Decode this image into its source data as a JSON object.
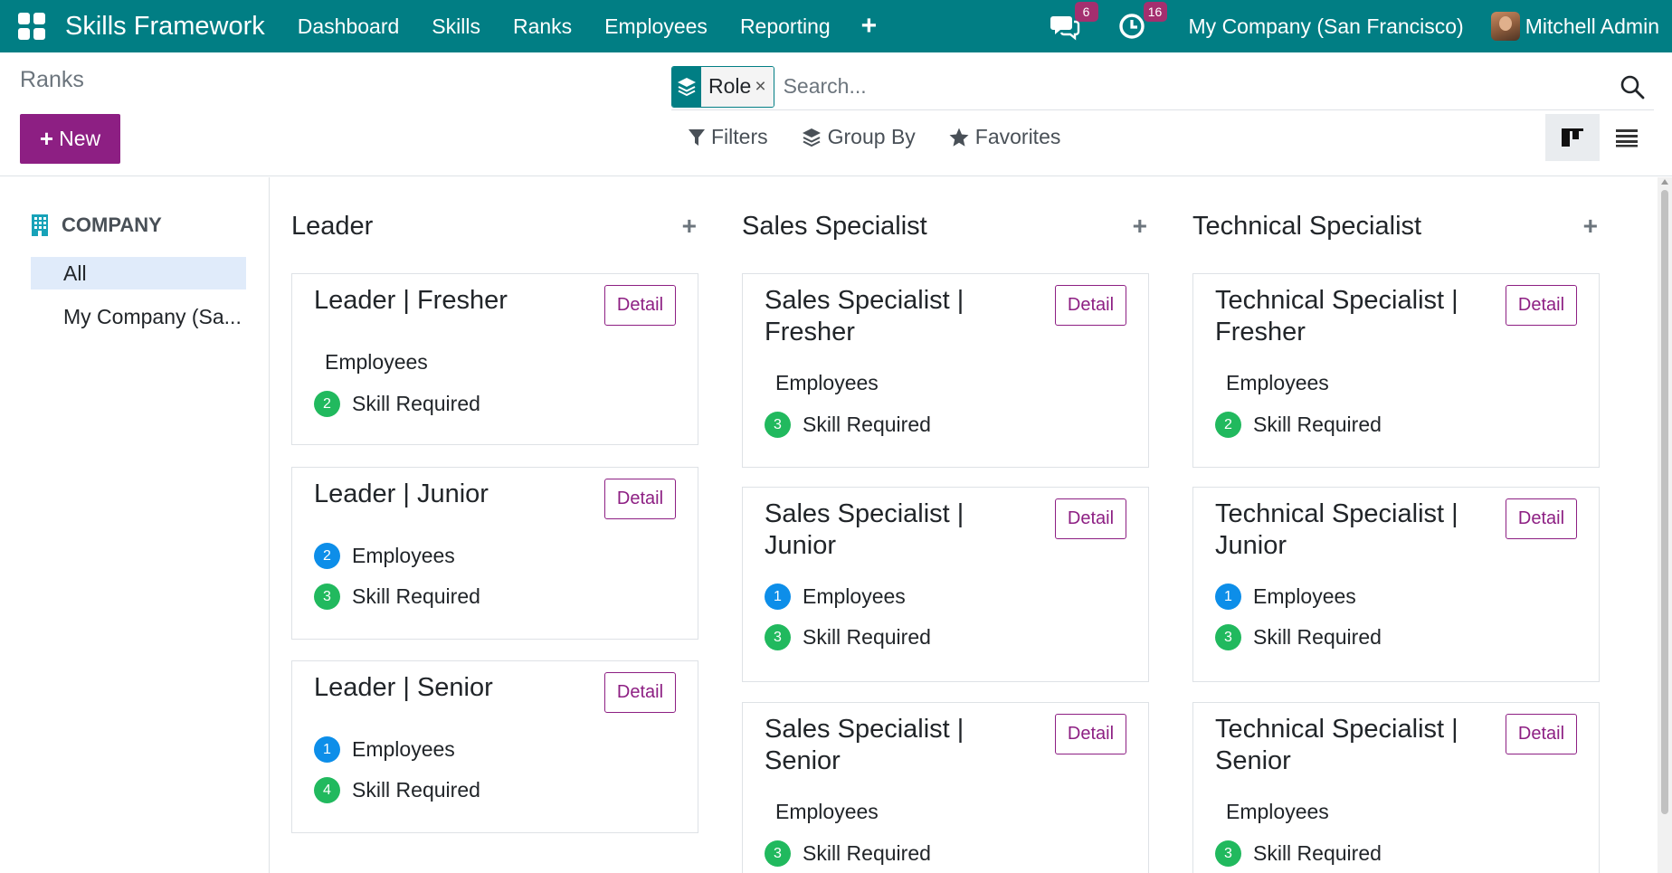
{
  "navbar": {
    "app_title": "Skills Framework",
    "menu": [
      "Dashboard",
      "Skills",
      "Ranks",
      "Employees",
      "Reporting"
    ],
    "plus_label": "+",
    "messages_count": "6",
    "activities_count": "16",
    "company": "My Company (San Francisco)",
    "user": "Mitchell Admin",
    "colors": {
      "bar": "#017e84",
      "badge": "#a42f6f"
    }
  },
  "control": {
    "breadcrumb": "Ranks",
    "new_label": "New",
    "facet_value": "Role",
    "facet_remove": "×",
    "search_placeholder": "Search...",
    "filters_label": "Filters",
    "groupby_label": "Group By",
    "favorites_label": "Favorites"
  },
  "sidebar": {
    "header": "COMPANY",
    "items": [
      {
        "label": "All",
        "active": true
      },
      {
        "label": "My Company (Sa..."
      }
    ]
  },
  "kanban": {
    "detail_label": "Detail",
    "add_symbol": "+",
    "columns": [
      {
        "title": "Leader",
        "cards": [
          {
            "title": "Leader | Fresher",
            "employees_label": "Employees",
            "employees_count": "",
            "skill_label": "Skill Required",
            "skill_count": "2"
          },
          {
            "title": "Leader | Junior",
            "employees_label": "Employees",
            "employees_count": "2",
            "skill_label": "Skill Required",
            "skill_count": "3"
          },
          {
            "title": "Leader | Senior",
            "employees_label": "Employees",
            "employees_count": "1",
            "skill_label": "Skill Required",
            "skill_count": "4"
          }
        ]
      },
      {
        "title": "Sales Specialist",
        "cards": [
          {
            "title": "Sales Specialist | Fresher",
            "employees_label": "Employees",
            "employees_count": "",
            "skill_label": "Skill Required",
            "skill_count": "3"
          },
          {
            "title": "Sales Specialist | Junior",
            "employees_label": "Employees",
            "employees_count": "1",
            "skill_label": "Skill Required",
            "skill_count": "3"
          },
          {
            "title": "Sales Specialist | Senior",
            "employees_label": "Employees",
            "employees_count": "",
            "skill_label": "Skill Required",
            "skill_count": "3"
          }
        ]
      },
      {
        "title": "Technical Specialist",
        "cards": [
          {
            "title": "Technical Specialist | Fresher",
            "employees_label": "Employees",
            "employees_count": "",
            "skill_label": "Skill Required",
            "skill_count": "2"
          },
          {
            "title": "Technical Specialist | Junior",
            "employees_label": "Employees",
            "employees_count": "1",
            "skill_label": "Skill Required",
            "skill_count": "3"
          },
          {
            "title": "Technical Specialist | Senior",
            "employees_label": "Employees",
            "employees_count": "",
            "skill_label": "Skill Required",
            "skill_count": "3"
          }
        ]
      }
    ]
  },
  "colors": {
    "primary": "#8d1f83",
    "employees_badge": "#0d8ee9",
    "skill_badge": "#21b95e",
    "sidebar_active": "#e0ebfa"
  }
}
